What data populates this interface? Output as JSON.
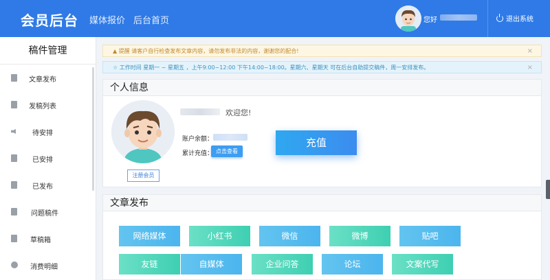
{
  "header": {
    "logo": "会员后台",
    "nav": [
      "媒体报价",
      "后台首页"
    ],
    "greeting": "您好",
    "logout": "退出系统"
  },
  "sidebar": {
    "title": "稿件管理",
    "items": [
      {
        "label": "文章发布",
        "icon": "document-icon"
      },
      {
        "label": "发稿列表",
        "icon": "list-icon"
      },
      {
        "label": "待安排",
        "icon": "speaker-icon"
      },
      {
        "label": "已安排",
        "icon": "gear-document-icon"
      },
      {
        "label": "已发布",
        "icon": "document-icon"
      },
      {
        "label": "问题稿件",
        "icon": "warning-document-icon"
      },
      {
        "label": "草稿箱",
        "icon": "drafts-icon"
      },
      {
        "label": "消费明细",
        "icon": "coin-icon"
      }
    ]
  },
  "alerts": {
    "warning": "提醒 请客户自行检查发布文章内容，请勿发布非法的内容，谢谢您的配合!",
    "info": "工作时间 星期一 ~ 星期五 ，上午9:00~12:00 下午14:00~18:00。星期六、星期天 可在后台自助提交稿件，周一安排发布。",
    "close": "×"
  },
  "profile": {
    "title": "个人信息",
    "welcome": "欢迎您!",
    "balance_label": "账户余额：",
    "total_label": "累计充值：",
    "view_button": "点击查看",
    "register_button": "注册会员",
    "recharge_button": "充值"
  },
  "publish": {
    "title": "文章发布",
    "row1": [
      "网络媒体",
      "小红书",
      "微信",
      "微博",
      "贴吧"
    ],
    "row2": [
      "友链",
      "自媒体",
      "企业问答",
      "论坛",
      "文案代写"
    ]
  },
  "colors": {
    "header": "#2f7ae6",
    "blue_tile": "#4cb5ee",
    "green_tile": "#3ecfb2",
    "recharge": "#3c8cef"
  }
}
